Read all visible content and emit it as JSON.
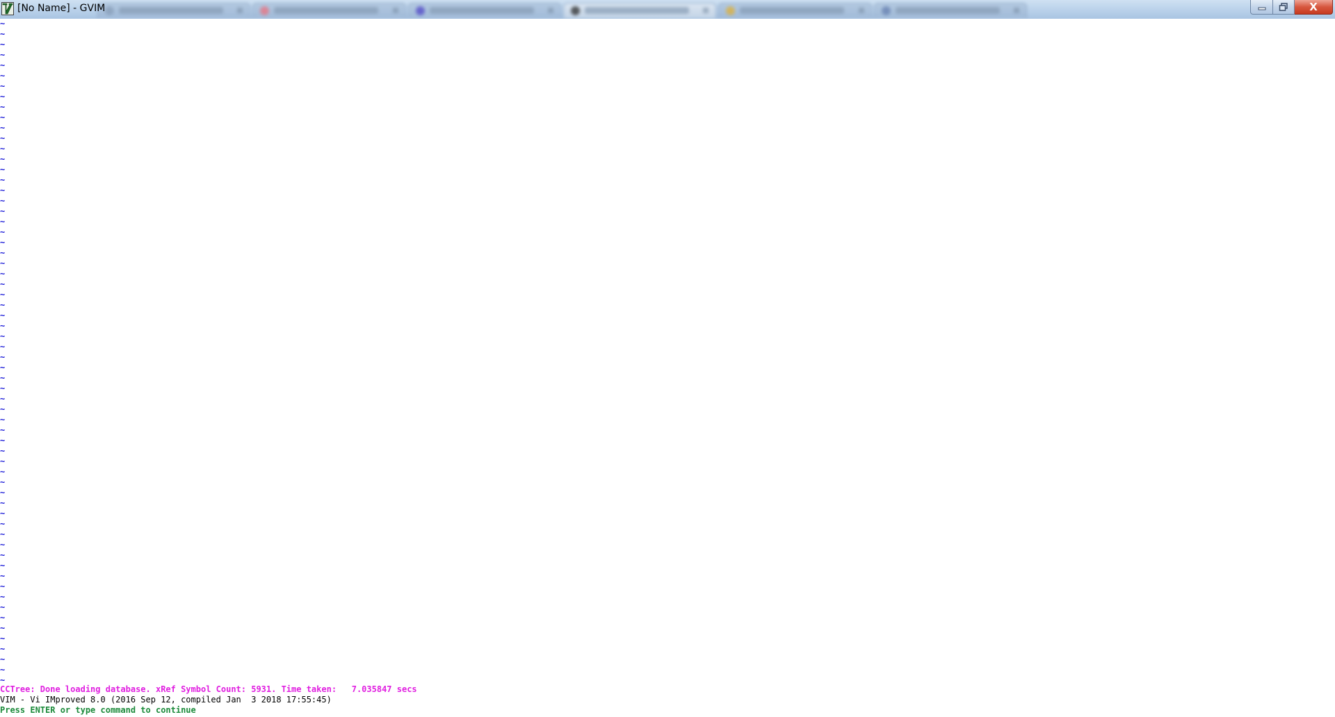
{
  "window": {
    "title": "[No Name] - GVIM",
    "buttons": {
      "minimize_icon": "minimize-icon",
      "maximize_icon": "restore-icon",
      "close_glyph": "X"
    }
  },
  "editor": {
    "empty_line_glyph": "~",
    "empty_line_count": 64,
    "tilde_color": "#1a1ad8"
  },
  "messages": {
    "cctree": "CCTree: Done loading database. xRef Symbol Count: 5931. Time taken:   7.035847 secs",
    "version": "VIM - Vi IMproved 8.0 (2016 Sep 12, compiled Jan  3 2018 17:55:45)",
    "prompt": "Press ENTER or type command to continue"
  },
  "colors": {
    "cctree_message": "#e01fe0",
    "prompt_message": "#1b8a3a",
    "close_button": "#d7573f"
  }
}
